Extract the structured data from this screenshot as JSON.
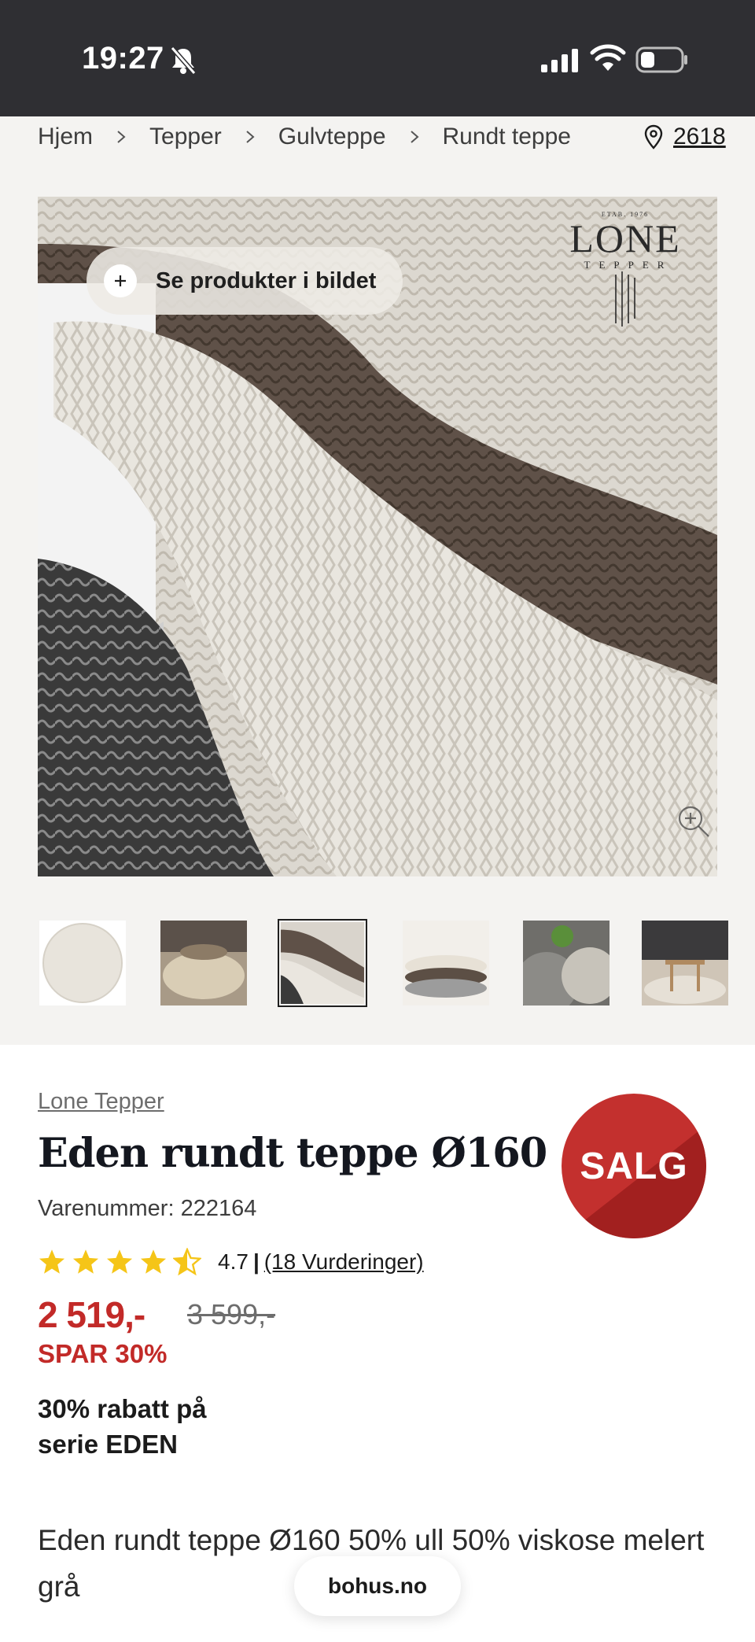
{
  "status_bar": {
    "time": "19:27",
    "icons": [
      "bell-slash-icon",
      "cellular-signal-icon",
      "wifi-icon",
      "battery-low-icon"
    ]
  },
  "breadcrumb": {
    "items": [
      "Hjem",
      "Tepper",
      "Gulvteppe",
      "Rundt teppe"
    ],
    "location_zip": "2618",
    "separator_icon": "chevron-right-icon",
    "location_icon": "location-pin-icon"
  },
  "gallery": {
    "see_products_label": "Se produkter i bildet",
    "brand_logo": {
      "small_line": "ETAB. 1976",
      "name": "LONE",
      "sub": "TEPPER"
    },
    "thumbnail_count": 6,
    "selected_thumbnail": 3
  },
  "product": {
    "vendor": "Lone Tepper",
    "title": "Eden rundt teppe Ø160",
    "sku": "Varenummer: 222164",
    "sale_badge": "SALG",
    "rating": {
      "stars": 4.5,
      "score": "4.7",
      "separator": "|",
      "reviews_link": "(18 Vurderinger)"
    },
    "price": "2 519,-",
    "old_price": "3 599,-",
    "save_label": "SPAR 30%",
    "promo": "30% rabatt på serie EDEN",
    "description": "Eden rundt teppe Ø160 50% ull 50% viskose melert grå"
  },
  "footer": {
    "site_label": "bohus.no"
  },
  "colors": {
    "sale_red": "#c22a28",
    "status_bar": "#2f2f33",
    "star_yellow": "#f5c518",
    "page_gray": "#f4f3f1"
  }
}
